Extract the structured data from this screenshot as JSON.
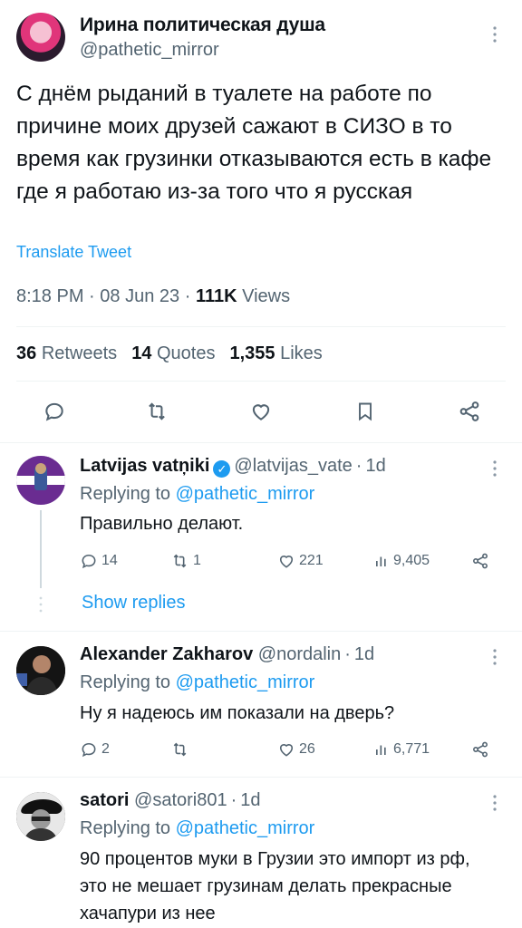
{
  "tweet": {
    "author_name": "Ирина политическая душа",
    "author_handle": "@pathetic_mirror",
    "text": "С днём рыданий в туалете на работе по причине моих друзей сажают в СИЗО в то время как грузинки отказываются есть в кафе где я работаю из-за того что я русская",
    "translate_label": "Translate Tweet",
    "time": "8:18 PM",
    "date": "08 Jun 23",
    "views_count": "111K",
    "views_label": "Views",
    "retweets_count": "36",
    "retweets_label": "Retweets",
    "quotes_count": "14",
    "quotes_label": "Quotes",
    "likes_count": "1,355",
    "likes_label": "Likes",
    "separator": "·"
  },
  "replies": [
    {
      "name": "Latvijas vatņiki",
      "verified": true,
      "handle": "@latvijas_vate",
      "age": "1d",
      "replying_prefix": "Replying to",
      "replying_to": "@pathetic_mirror",
      "text": "Правильно делают.",
      "reply_count": "14",
      "retweet_count": "1",
      "like_count": "221",
      "view_count": "9,405",
      "show_replies": "Show replies"
    },
    {
      "name": "Alexander Zakharov",
      "verified": false,
      "handle": "@nordalin",
      "age": "1d",
      "replying_prefix": "Replying to",
      "replying_to": "@pathetic_mirror",
      "text": "Ну я надеюсь им показали на дверь?",
      "reply_count": "2",
      "retweet_count": "",
      "like_count": "26",
      "view_count": "6,771"
    },
    {
      "name": "satori",
      "verified": false,
      "handle": "@satori801",
      "age": "1d",
      "replying_prefix": "Replying to",
      "replying_to": "@pathetic_mirror",
      "text": "90 процентов муки в Грузии это импорт из рф, это не мешает грузинам делать прекрасные хачапури из нее"
    }
  ],
  "icons": {
    "reply": "reply-icon",
    "retweet": "retweet-icon",
    "like": "heart-icon",
    "bookmark": "bookmark-icon",
    "share": "share-icon",
    "views": "views-icon",
    "more": "more-vertical-icon"
  },
  "colors": {
    "link": "#1d9bf0",
    "secondary": "#536471",
    "primary_text": "#0f1419",
    "divider": "#eff3f4"
  }
}
